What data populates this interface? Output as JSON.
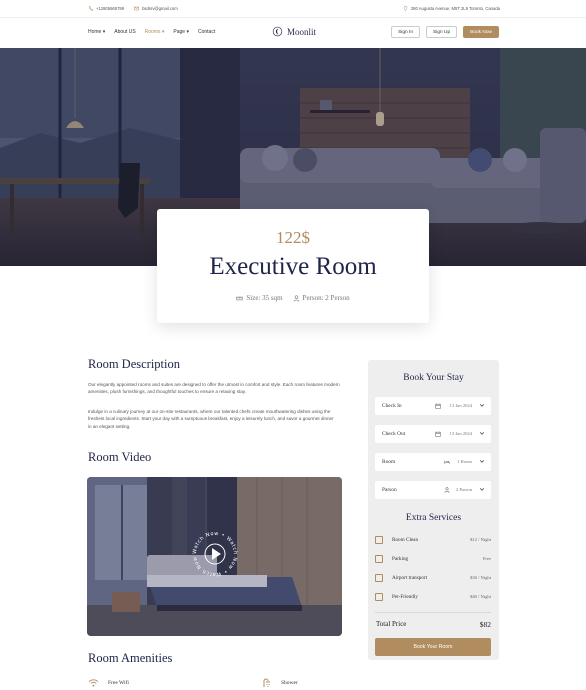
{
  "topbar": {
    "phone": "+12805665799",
    "email": "bsdsrv@gmail.com",
    "address": "280 Augusta Avenue, M5T 2L9 Toronto, Canada"
  },
  "nav": {
    "items": [
      {
        "label": "Home",
        "dropdown": true
      },
      {
        "label": "About US",
        "dropdown": false
      },
      {
        "label": "Rooms",
        "dropdown": true,
        "active": true
      },
      {
        "label": "Page",
        "dropdown": true
      },
      {
        "label": "Contact",
        "dropdown": false
      }
    ],
    "logo": "Moonlit",
    "sign_in": "Sign In",
    "sign_up": "Sign Up",
    "book_now": "Book Now"
  },
  "room": {
    "price": "122$",
    "title": "Executive Room",
    "size": "Size: 35 sqm",
    "person": "Person: 2 Person"
  },
  "description": {
    "heading": "Room Description",
    "p1": "Our elegantly appointed rooms and suites are designed to offer the utmost in comfort and style. Each room features modern amenities, plush furnishings, and thoughtful touches to ensure a relaxing stay.",
    "p2": "Indulge in a culinary journey at our on-site restaurants, where our talented chefs create mouthwatering dishes using the freshest local ingredients. Start your day with a sumptuous breakfast, enjoy a leisurely lunch, and savor a gourmet dinner in an elegant setting."
  },
  "video": {
    "heading": "Room Video",
    "badge_text": "Watch Now • Watch Now • Watch Now •"
  },
  "amenities": {
    "heading": "Room Amenities",
    "items": [
      "Free Wifi",
      "Shower"
    ]
  },
  "booking": {
    "heading": "Book Your Stay",
    "fields": [
      {
        "label": "Check In",
        "value": "13 Jun 2024",
        "icon": "calendar-icon"
      },
      {
        "label": "Check Out",
        "value": "13 Jun 2024",
        "icon": "calendar-icon"
      },
      {
        "label": "Room",
        "value": "1 Room",
        "icon": "bed-icon"
      },
      {
        "label": "Parson",
        "value": "2 Parson",
        "icon": "person-icon"
      }
    ],
    "extra_heading": "Extra Services",
    "services": [
      {
        "name": "Room Clean",
        "price": "$12 / Night"
      },
      {
        "name": "Parking",
        "price": "Free"
      },
      {
        "name": "Airport transport",
        "price": "$30 / Night"
      },
      {
        "name": "Pet-Friendly",
        "price": "$40 / Night"
      }
    ],
    "total_label": "Total Price",
    "total_value": "$82",
    "button": "Book Your Room"
  },
  "colors": {
    "accent": "#b08c5f",
    "navy": "#1f2448",
    "sidebar": "#eeeeef"
  }
}
